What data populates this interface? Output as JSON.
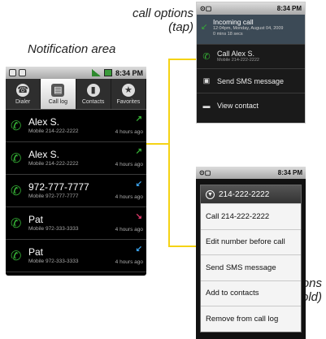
{
  "captions": {
    "call_options": "call options\n(tap)",
    "notification_area": "Notification area",
    "entry_options": "entry-specific options\n(touch and hold)"
  },
  "main": {
    "status": {
      "time": "8:34 PM"
    },
    "tabs": [
      {
        "label": "Dialer",
        "icon": "dialer-icon",
        "glyph": "☎"
      },
      {
        "label": "Call log",
        "icon": "call-log-icon",
        "glyph": "▤",
        "active": true
      },
      {
        "label": "Contacts",
        "icon": "contacts-icon",
        "glyph": "▮"
      },
      {
        "label": "Favorites",
        "icon": "star-icon",
        "glyph": "★"
      }
    ],
    "calls": [
      {
        "name": "Alex S.",
        "number": "Mobile 214-222-2222",
        "ago": "4 hours ago",
        "dir": "outgoing",
        "dir_glyph": "↗",
        "dir_color": "#36b236"
      },
      {
        "name": "Alex S.",
        "number": "Mobile 214-222-2222",
        "ago": "4 hours ago",
        "dir": "outgoing",
        "dir_glyph": "↗",
        "dir_color": "#36b236"
      },
      {
        "name": "972-777-7777",
        "number": "Mobile 972-777-7777",
        "ago": "4 hours ago",
        "dir": "incoming",
        "dir_glyph": "↙",
        "dir_color": "#3aa0e8"
      },
      {
        "name": "Pat",
        "number": "Mobile 972-333-3333",
        "ago": "4 hours ago",
        "dir": "missed",
        "dir_glyph": "↘",
        "dir_color": "#e23a6c"
      },
      {
        "name": "Pat",
        "number": "Mobile 972-333-3333",
        "ago": "4 hours ago",
        "dir": "incoming",
        "dir_glyph": "↙",
        "dir_color": "#3aa0e8"
      }
    ]
  },
  "call_options": {
    "time": "8:34 PM",
    "incoming_title": "Incoming call",
    "incoming_date": "12:04pm, Monday, August 04, 2009",
    "incoming_duration": "0 mins 18 secs",
    "call_label": "Call Alex S.",
    "call_sub": "Mobile 214-222-2222",
    "sms_label": "Send SMS message",
    "view_label": "View contact"
  },
  "context_menu": {
    "time": "8:34 PM",
    "header": "214-222-2222",
    "items": [
      "Call 214-222-2222",
      "Edit number before call",
      "Send SMS message",
      "Add to contacts",
      "Remove from call log"
    ]
  },
  "colors": {
    "connector": "#f5d315",
    "accent": "#36b236"
  }
}
